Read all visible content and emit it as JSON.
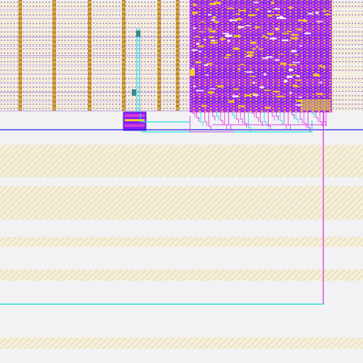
{
  "view": {
    "kind": "IC layout editor canvas",
    "background_color": "#f2f2f4"
  },
  "layers": [
    {
      "name": "metal1",
      "color": "#1e1ee0"
    },
    {
      "name": "metal2",
      "color": "#e040e0"
    },
    {
      "name": "metal3",
      "color": "#22dddd"
    },
    {
      "name": "poly",
      "color": "#b400ff"
    },
    {
      "name": "diffusion",
      "color": "#f0d020"
    },
    {
      "name": "well",
      "color": "#e8d8a8"
    },
    {
      "name": "contact",
      "color": "#b88a30"
    },
    {
      "name": "via",
      "color": "#3a8a8a"
    }
  ],
  "icons": [
    "standard-cell-row",
    "macro-block",
    "io-cell",
    "routing-wire",
    "power-stripe"
  ]
}
